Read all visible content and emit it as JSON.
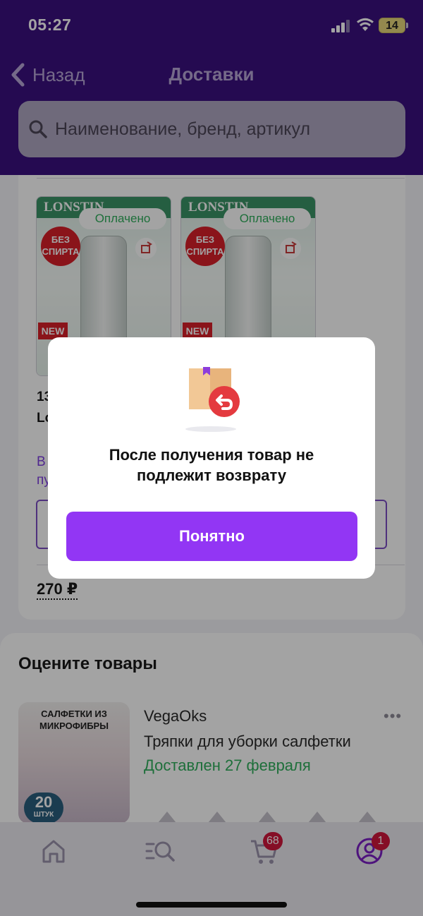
{
  "status_bar": {
    "time": "05:27",
    "battery": "14"
  },
  "nav": {
    "back_label": "Назад",
    "title": "Доставки"
  },
  "search": {
    "placeholder": "Наименование, бренд, артикул"
  },
  "delivery_card": {
    "products": [
      {
        "brand_text": "LONSTIN",
        "badge": "БЕЗ СПИРТА",
        "new_label": "NEW",
        "status": "Оплачено"
      },
      {
        "brand_text": "LONSTIN",
        "badge": "БЕЗ СПИРТА",
        "new_label": "NEW",
        "status": "Оплачено"
      }
    ],
    "partial_line1": "13",
    "partial_line2": "Lo",
    "partial_purple1": "В",
    "partial_purple2": "пу",
    "price": "270 ₽"
  },
  "rate_section": {
    "title": "Оцените товары",
    "item": {
      "image_title": "САЛФЕТКИ ИЗ МИКРОФИБРЫ",
      "image_count": "20",
      "image_count_unit": "ШТУК",
      "brand": "VegaOks",
      "name": "Тряпки для уборки салфетки",
      "status": "Доставлен 27 февраля",
      "more": "•••"
    }
  },
  "tabbar": {
    "cart_badge": "68",
    "profile_badge": "1"
  },
  "modal": {
    "message": "После получения товар не подлежит возврату",
    "button_label": "Понятно"
  },
  "colors": {
    "header_bg": "#3b117f",
    "accent": "#9236f4",
    "success": "#2fae5c",
    "badge": "#d0163c"
  }
}
